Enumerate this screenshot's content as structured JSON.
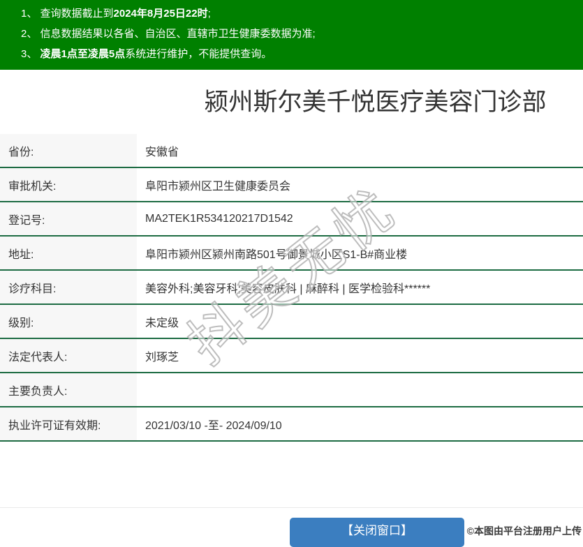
{
  "notices": [
    {
      "num": "1、 ",
      "pre": "查询数据截止到",
      "bold": "2024年8月25日22时",
      "post": ";"
    },
    {
      "num": "2、 ",
      "pre": "信息数据结果以各省、自治区、直辖市卫生健康委数据为准;",
      "bold": "",
      "post": ""
    },
    {
      "num": "3、 ",
      "pre": "",
      "bold": "凌晨1点至凌晨5点",
      "post": "系统进行维护，不能提供查询。"
    }
  ],
  "title": "颍州斯尔美千悦医疗美容门诊部",
  "fields": [
    {
      "label": "省份:",
      "value": "安徽省"
    },
    {
      "label": "审批机关:",
      "value": "阜阳市颍州区卫生健康委员会"
    },
    {
      "label": "登记号:",
      "value": "MA2TEK1R534120217D1542"
    },
    {
      "label": "地址:",
      "value": "阜阳市颍州区颍州南路501号御景城小区S1-B#商业楼"
    },
    {
      "label": "诊疗科目:",
      "value": "美容外科;美容牙科;美容皮肤科 | 麻醉科 | 医学检验科******"
    },
    {
      "label": "级别:",
      "value": "未定级"
    },
    {
      "label": "法定代表人:",
      "value": "刘琢芝"
    },
    {
      "label": "主要负责人:",
      "value": ""
    },
    {
      "label": "执业许可证有效期:",
      "value": "2021/03/10 -至- 2024/09/10"
    }
  ],
  "close_button_label": "【关闭窗口】",
  "watermark_text": "抖美无忧",
  "copyright_text": "©本图由平台注册用户上传",
  "colors": {
    "banner_green": "#008000",
    "divider_green": "#1c6b42",
    "button_blue": "#3b7ec0",
    "label_bg": "#f7f7f7",
    "text": "#333333"
  }
}
